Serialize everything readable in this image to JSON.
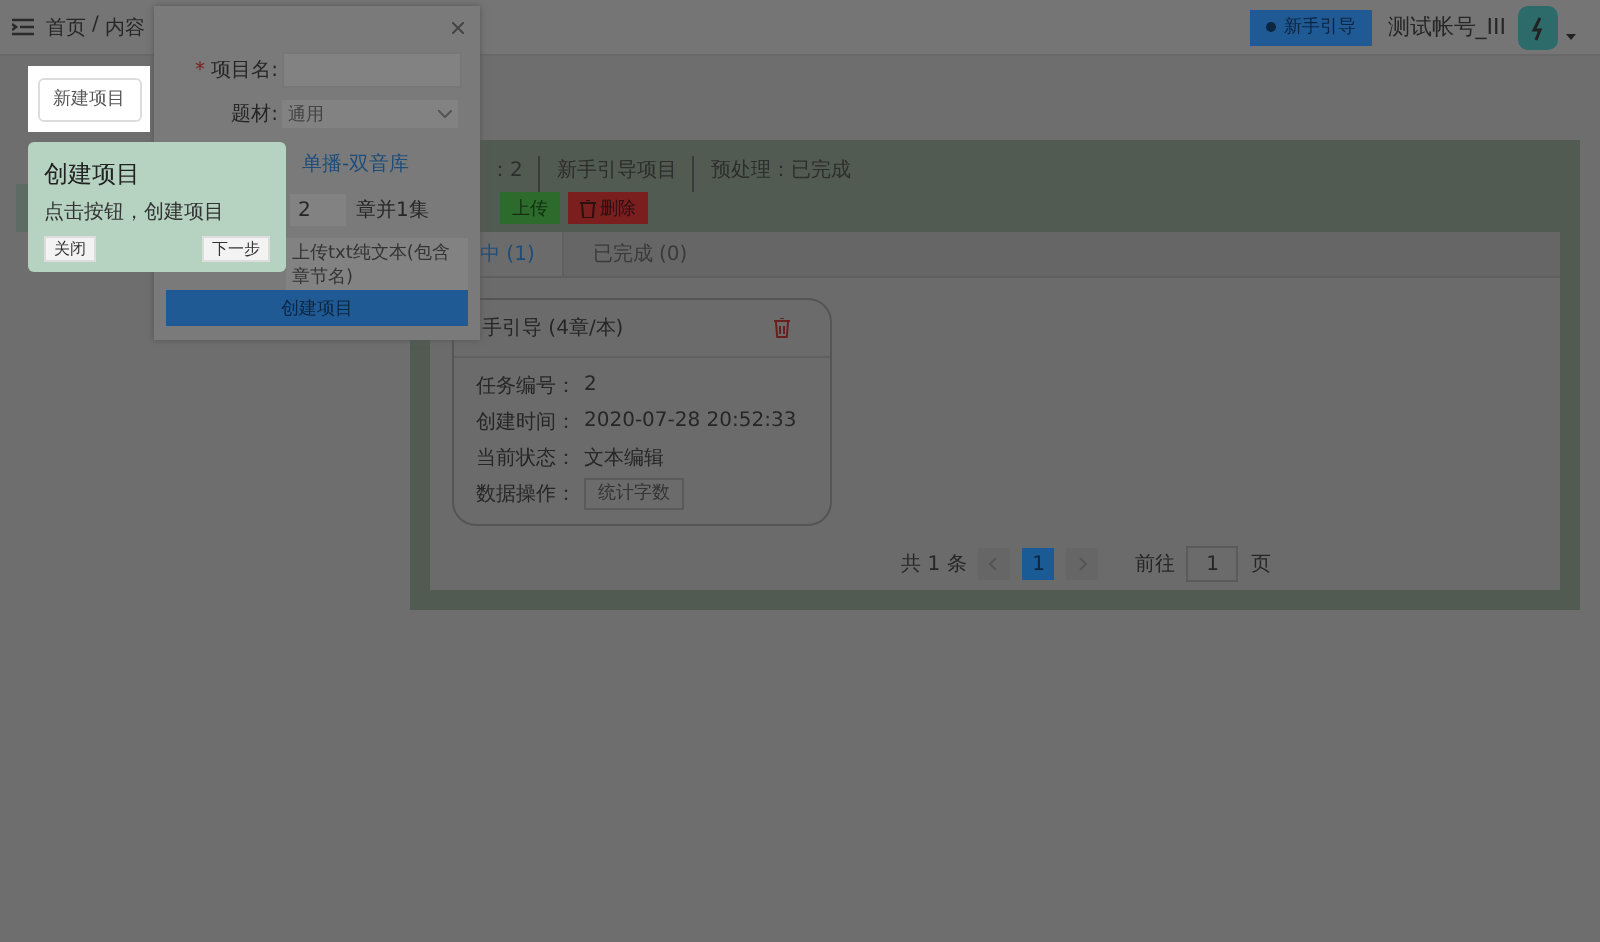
{
  "header": {
    "breadcrumb": [
      "首页",
      "/",
      "内容"
    ],
    "guide_button": "新手引导",
    "account": "测试帐号_III"
  },
  "highlight_button": "新建项目",
  "tour_popover": {
    "title": "创建项目",
    "text": "点击按钮，创建项目",
    "buttons": [
      "关闭",
      "下一步"
    ]
  },
  "dialog": {
    "fields": [
      {
        "kind": "textarea",
        "required_mark": "*",
        "label": "项目名:"
      },
      {
        "kind": "select",
        "label": "题材:",
        "value": "通用"
      },
      {
        "kind": "link",
        "text": "单播-双音库"
      },
      {
        "kind": "number",
        "value": "2",
        "suffix": "章并1集"
      },
      {
        "kind": "upload",
        "placeholder": "上传txt纯文本(包含章节名)"
      }
    ],
    "submit": "创建项目"
  },
  "project": {
    "info": [
      "：2",
      "新手引导项目",
      "预处理：已完成"
    ],
    "actions": [
      {
        "label": "上传",
        "kind": "success"
      },
      {
        "label": "删除",
        "kind": "danger"
      }
    ],
    "tabs": [
      {
        "label": "中 (1)",
        "selected": true
      },
      {
        "label": "已完成 (0)",
        "selected": false
      }
    ],
    "card": {
      "title": "手引导 (4章/本)",
      "rows": [
        {
          "label": "任务编号：",
          "value": "2"
        },
        {
          "label": "创建时间：",
          "value": "2020-07-28 20:52:33"
        },
        {
          "label": "当前状态：",
          "value": "文本编辑"
        },
        {
          "label": "数据操作：",
          "button": "统计字数"
        }
      ]
    },
    "pagination": {
      "total": "共 1 条",
      "pages": [
        {
          "label": "1",
          "selected": true
        }
      ],
      "goto": "前往",
      "page_input": "1",
      "unit": "页"
    }
  }
}
